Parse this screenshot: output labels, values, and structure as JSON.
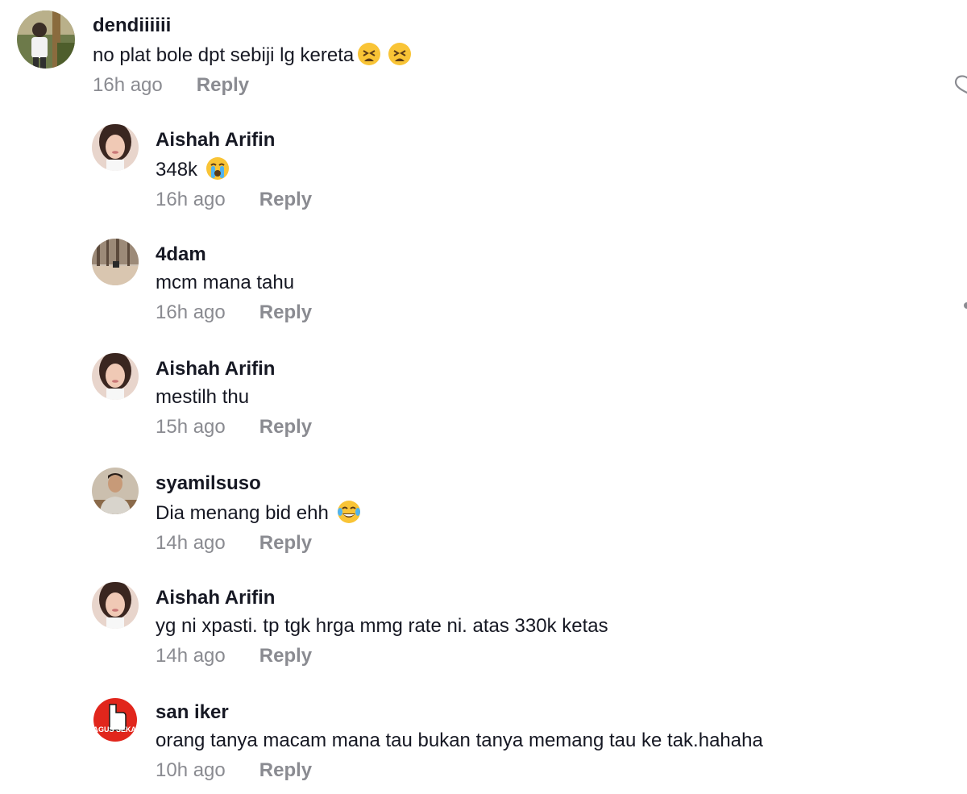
{
  "comments": [
    {
      "username": "dendiiiiii",
      "text": "no plat bole dpt sebiji lg kereta",
      "emojis": [
        "tired-face",
        "tired-face"
      ],
      "time": "16h ago",
      "reply_label": "Reply"
    },
    {
      "username": "Aishah Arifin",
      "text": "348k",
      "emojis": [
        "crying-face"
      ],
      "time": "16h ago",
      "reply_label": "Reply"
    },
    {
      "username": "4dam",
      "text": "mcm mana tahu",
      "emojis": [],
      "time": "16h ago",
      "reply_label": "Reply"
    },
    {
      "username": "Aishah Arifin",
      "text": "mestilh thu",
      "emojis": [],
      "time": "15h ago",
      "reply_label": "Reply"
    },
    {
      "username": "syamilsuso",
      "text": "Dia menang bid ehh",
      "emojis": [
        "tears-of-joy-face"
      ],
      "time": "14h ago",
      "reply_label": "Reply"
    },
    {
      "username": "Aishah Arifin",
      "text": "yg ni xpasti. tp tgk hrga mmg rate ni. atas 330k ketas",
      "emojis": [],
      "time": "14h ago",
      "reply_label": "Reply"
    },
    {
      "username": "san iker",
      "text": "orang tanya macam mana tau bukan tanya memang tau ke tak.hahaha",
      "emojis": [],
      "time": "10h ago",
      "reply_label": "Reply",
      "avatar_text": "BAGUS SEKALI"
    }
  ],
  "icons": {
    "like": "heart-outline-icon",
    "more": "more-dots-icon"
  },
  "colors": {
    "text": "#161823",
    "muted": "#8a8b91",
    "background": "#ffffff"
  }
}
